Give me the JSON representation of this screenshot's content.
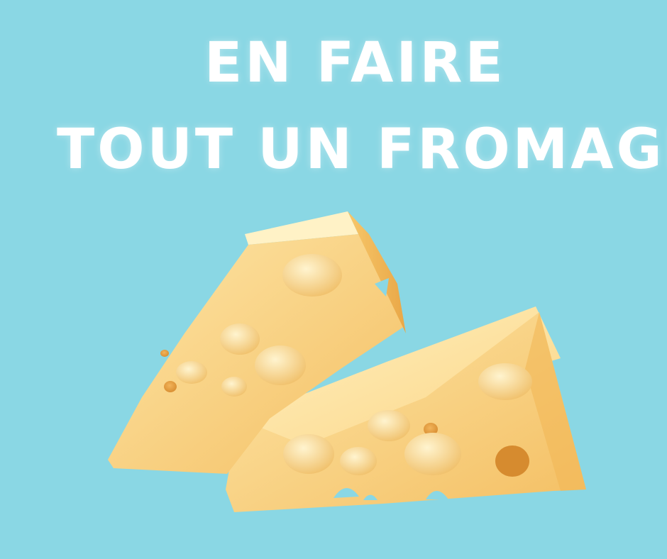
{
  "headline": {
    "line1": "EN FAIRE",
    "line2": "TOUT UN FROMAGE"
  },
  "colors": {
    "background": "#8ad7e4",
    "text": "#ffffff",
    "cheese_light": "#fde3a0",
    "cheese_mid": "#f7c76a",
    "cheese_dark": "#e5a543"
  },
  "image": {
    "subject": "two-swiss-cheese-wedges"
  }
}
